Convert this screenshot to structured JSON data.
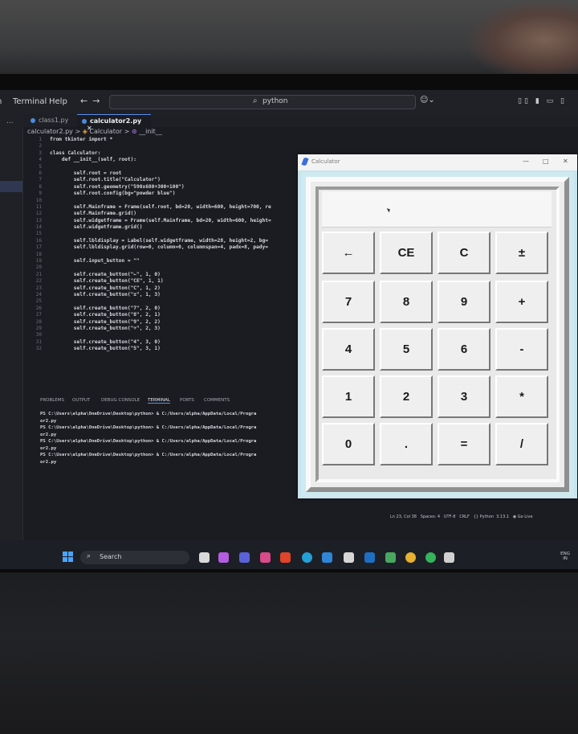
{
  "menu": {
    "terminal": "Terminal",
    "help": "Help",
    "back": "←",
    "forward": "→"
  },
  "command_center": {
    "text": "python"
  },
  "sidebar": {
    "more": "..."
  },
  "tabs": [
    {
      "label": "class1.py"
    },
    {
      "label": "calculator2.py",
      "close": "✕"
    }
  ],
  "breadcrumb": {
    "file": "calculator2.py",
    "sep1": ">",
    "class": "Calculator",
    "sep2": ">",
    "method": "__init__"
  },
  "editor": {
    "line_numbers": [
      "1",
      "2",
      "3",
      "4",
      "5",
      "6",
      "7",
      "8",
      "9",
      "10",
      "11",
      "12",
      "13",
      "14",
      "15",
      "16",
      "17",
      "18",
      "19",
      "20",
      "21",
      "22",
      "23",
      "24",
      "25",
      "26",
      "27",
      "28",
      "29",
      "30",
      "31",
      "32"
    ],
    "lines": [
      "from tkinter import *",
      "",
      "class Calculator:",
      "    def __init__(self, root):",
      "",
      "        self.root = root",
      "        self.root.title(\"Calculator\")",
      "        self.root.geometry(\"590x680+300+100\")",
      "        self.root.config(bg=\"powder blue\")",
      "",
      "        self.Mainframe = Frame(self.root, bd=20, width=600, height=700, re",
      "        self.Mainframe.grid()",
      "        self.widgetframe = Frame(self.Mainframe, bd=20, width=600, height=",
      "        self.widgetframe.grid()",
      "",
      "        self.lbldisplay = Label(self.widgetframe, width=28, height=2, bg=",
      "        self.lbldisplay.grid(row=0, column=0, columnspan=4, padx=8, pady=",
      "",
      "        self.input_button = \"\"",
      "",
      "        self.create_button(\"←\", 1, 0)",
      "        self.create_button(\"CE\", 1, 1)",
      "        self.create_button(\"C\", 1, 2)",
      "        self.create_button(\"±\", 1, 3)",
      "",
      "        self.create_button(\"7\", 2, 0)",
      "        self.create_button(\"8\", 2, 1)",
      "        self.create_button(\"9\", 2, 2)",
      "        self.create_button(\"+\", 2, 3)",
      "",
      "        self.create_button(\"4\", 3, 0)",
      "        self.create_button(\"5\", 3, 1)"
    ]
  },
  "panel": {
    "tabs": [
      "PROBLEMS",
      "OUTPUT",
      "DEBUG CONSOLE",
      "TERMINAL",
      "PORTS",
      "COMMENTS"
    ],
    "active_tab": "TERMINAL"
  },
  "terminal": {
    "lines": [
      "PS C:\\Users\\alpha\\OneDrive\\Desktop\\python> & C:/Users/alpha/AppData/Local/Progra",
      "or2.py",
      "PS C:\\Users\\alpha\\OneDrive\\Desktop\\python> & C:/Users/alpha/AppData/Local/Progra",
      "or2.py",
      "PS C:\\Users\\alpha\\OneDrive\\Desktop\\python> & C:/Users/alpha/AppData/Local/Progra",
      "or2.py",
      "PS C:\\Users\\alpha\\OneDrive\\Desktop\\python> & C:/Users/alpha/AppData/Local/Progra",
      "or2.py"
    ]
  },
  "status_bar": {
    "position": "Ln 23, Col 38",
    "spaces": "Spaces: 4",
    "encoding": "UTF-8",
    "eol": "CRLF",
    "language": "Python",
    "version": "3.13.1",
    "golive": "Go Live"
  },
  "taskbar": {
    "search_placeholder": "Search",
    "tray_lang_1": "ENG",
    "tray_lang_2": "IN"
  },
  "calculator": {
    "title": "Calculator",
    "display_value": "",
    "buttons": [
      [
        "←",
        "CE",
        "C",
        "±"
      ],
      [
        "7",
        "8",
        "9",
        "+"
      ],
      [
        "4",
        "5",
        "6",
        "-"
      ],
      [
        "1",
        "2",
        "3",
        "*"
      ],
      [
        "0",
        ".",
        "=",
        "/"
      ]
    ]
  },
  "colors": {
    "accent": "#5b8ef0",
    "calculator_bg": "#b0e0e6",
    "editor_bg": "#1b1c22"
  }
}
